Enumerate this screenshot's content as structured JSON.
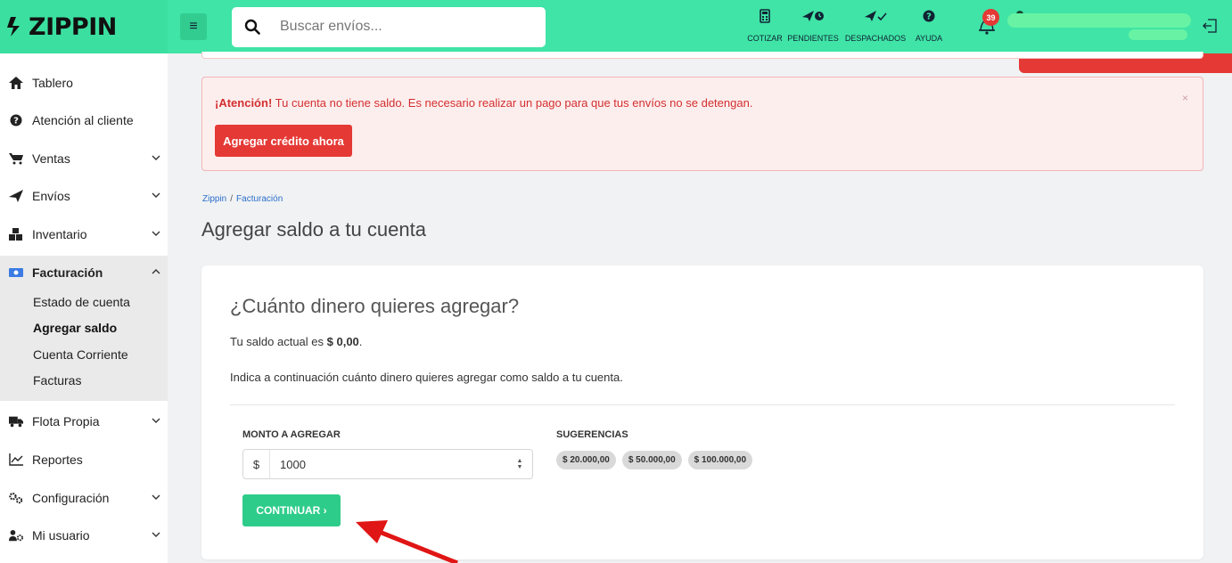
{
  "brand": {
    "name": "ZIPPIN",
    "accent": "#3fe4a6"
  },
  "search": {
    "placeholder": "Buscar envíos..."
  },
  "nav": [
    {
      "label": "COTIZAR",
      "icon": "calculator-icon"
    },
    {
      "label": "PENDIENTES",
      "icon": "paper-plane-clock-icon"
    },
    {
      "label": "DESPACHADOS",
      "icon": "paper-plane-check-icon"
    },
    {
      "label": "AYUDA",
      "icon": "question-circle-icon"
    }
  ],
  "notifications": {
    "count": "39"
  },
  "sidebar": {
    "items": [
      {
        "label": "Tablero",
        "icon": "home-icon"
      },
      {
        "label": "Atención al cliente",
        "icon": "question-circle-icon"
      },
      {
        "label": "Ventas",
        "icon": "cart-icon"
      },
      {
        "label": "Envíos",
        "icon": "paper-plane-icon"
      },
      {
        "label": "Inventario",
        "icon": "boxes-icon"
      },
      {
        "label": "Facturación",
        "icon": "money-bill-icon"
      },
      {
        "label": "Flota Propia",
        "icon": "truck-icon"
      },
      {
        "label": "Reportes",
        "icon": "chart-line-icon"
      },
      {
        "label": "Configuración",
        "icon": "cogs-icon"
      },
      {
        "label": "Mi usuario",
        "icon": "user-cog-icon"
      }
    ],
    "facturacion_sub": [
      "Estado de cuenta",
      "Agregar saldo",
      "Cuenta Corriente",
      "Facturas"
    ]
  },
  "alert": {
    "strong": "¡Atención!",
    "text": " Tu cuenta no tiene saldo. Es necesario realizar un pago para que tus envíos no se detengan.",
    "button": "Agregar crédito ahora",
    "close": "×",
    "color": "#e53935"
  },
  "breadcrumb": {
    "home": "Zippin",
    "current": "Facturación",
    "sep": "/"
  },
  "page": {
    "title": "Agregar saldo a tu cuenta"
  },
  "card": {
    "title": "¿Cuánto dinero quieres agregar?",
    "saldo_prefix": "Tu saldo actual es ",
    "saldo_value": "$ 0,00",
    "saldo_suffix": ".",
    "info": "Indica a continuación cuánto dinero quieres agregar como saldo a tu cuenta.",
    "monto_label": "MONTO A AGREGAR",
    "currency": "$",
    "amount": "1000",
    "sugerencias_label": "SUGERENCIAS",
    "suggestions": [
      "$ 20.000,00",
      "$ 50.000,00",
      "$ 100.000,00"
    ],
    "continue": "CONTINUAR ›"
  }
}
